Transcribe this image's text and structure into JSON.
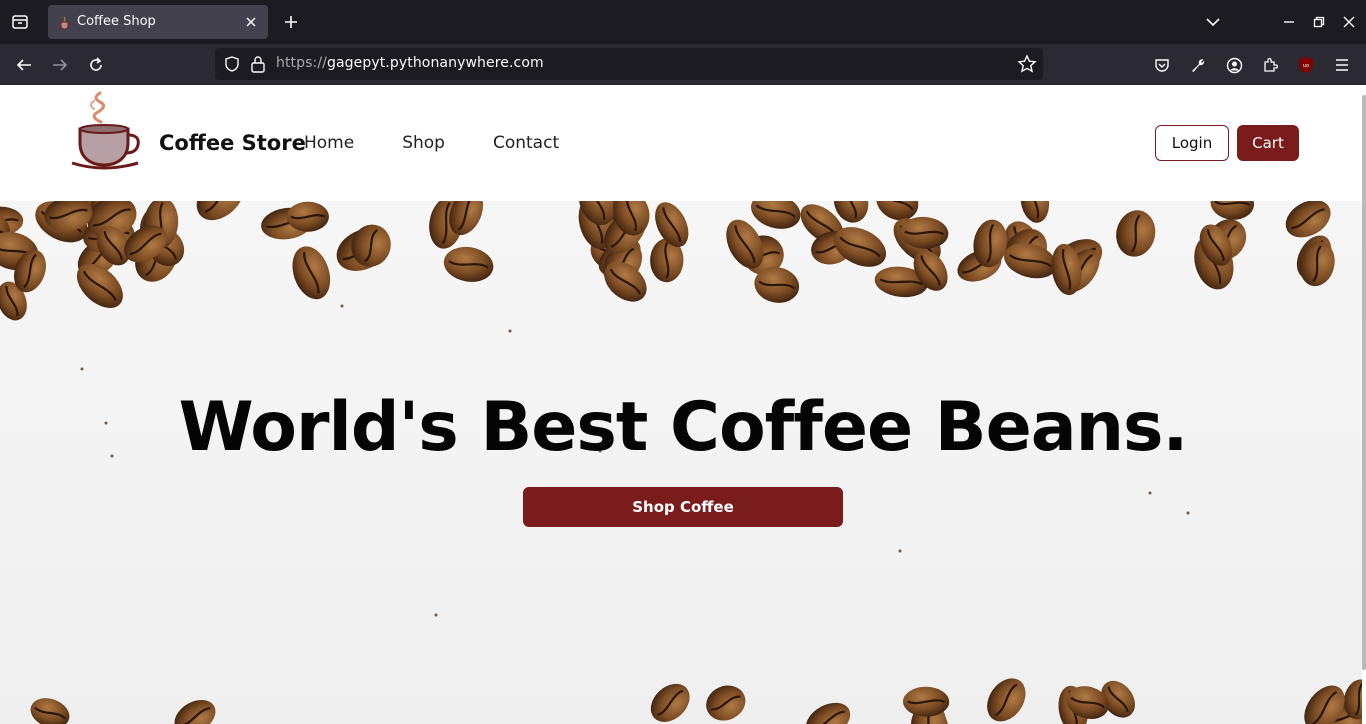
{
  "browser": {
    "tab_title": "Coffee Shop",
    "url_scheme": "https://",
    "url_host": "gagepyt.pythonanywhere.com"
  },
  "site": {
    "brand": "Coffee Store",
    "menu": [
      {
        "label": "Home"
      },
      {
        "label": "Shop"
      },
      {
        "label": "Contact"
      }
    ],
    "login_label": "Login",
    "cart_label": "Cart",
    "accent_color": "#7a1c1c"
  },
  "hero": {
    "title": "World's Best Coffee Beans.",
    "button_label": "Shop Coffee"
  }
}
